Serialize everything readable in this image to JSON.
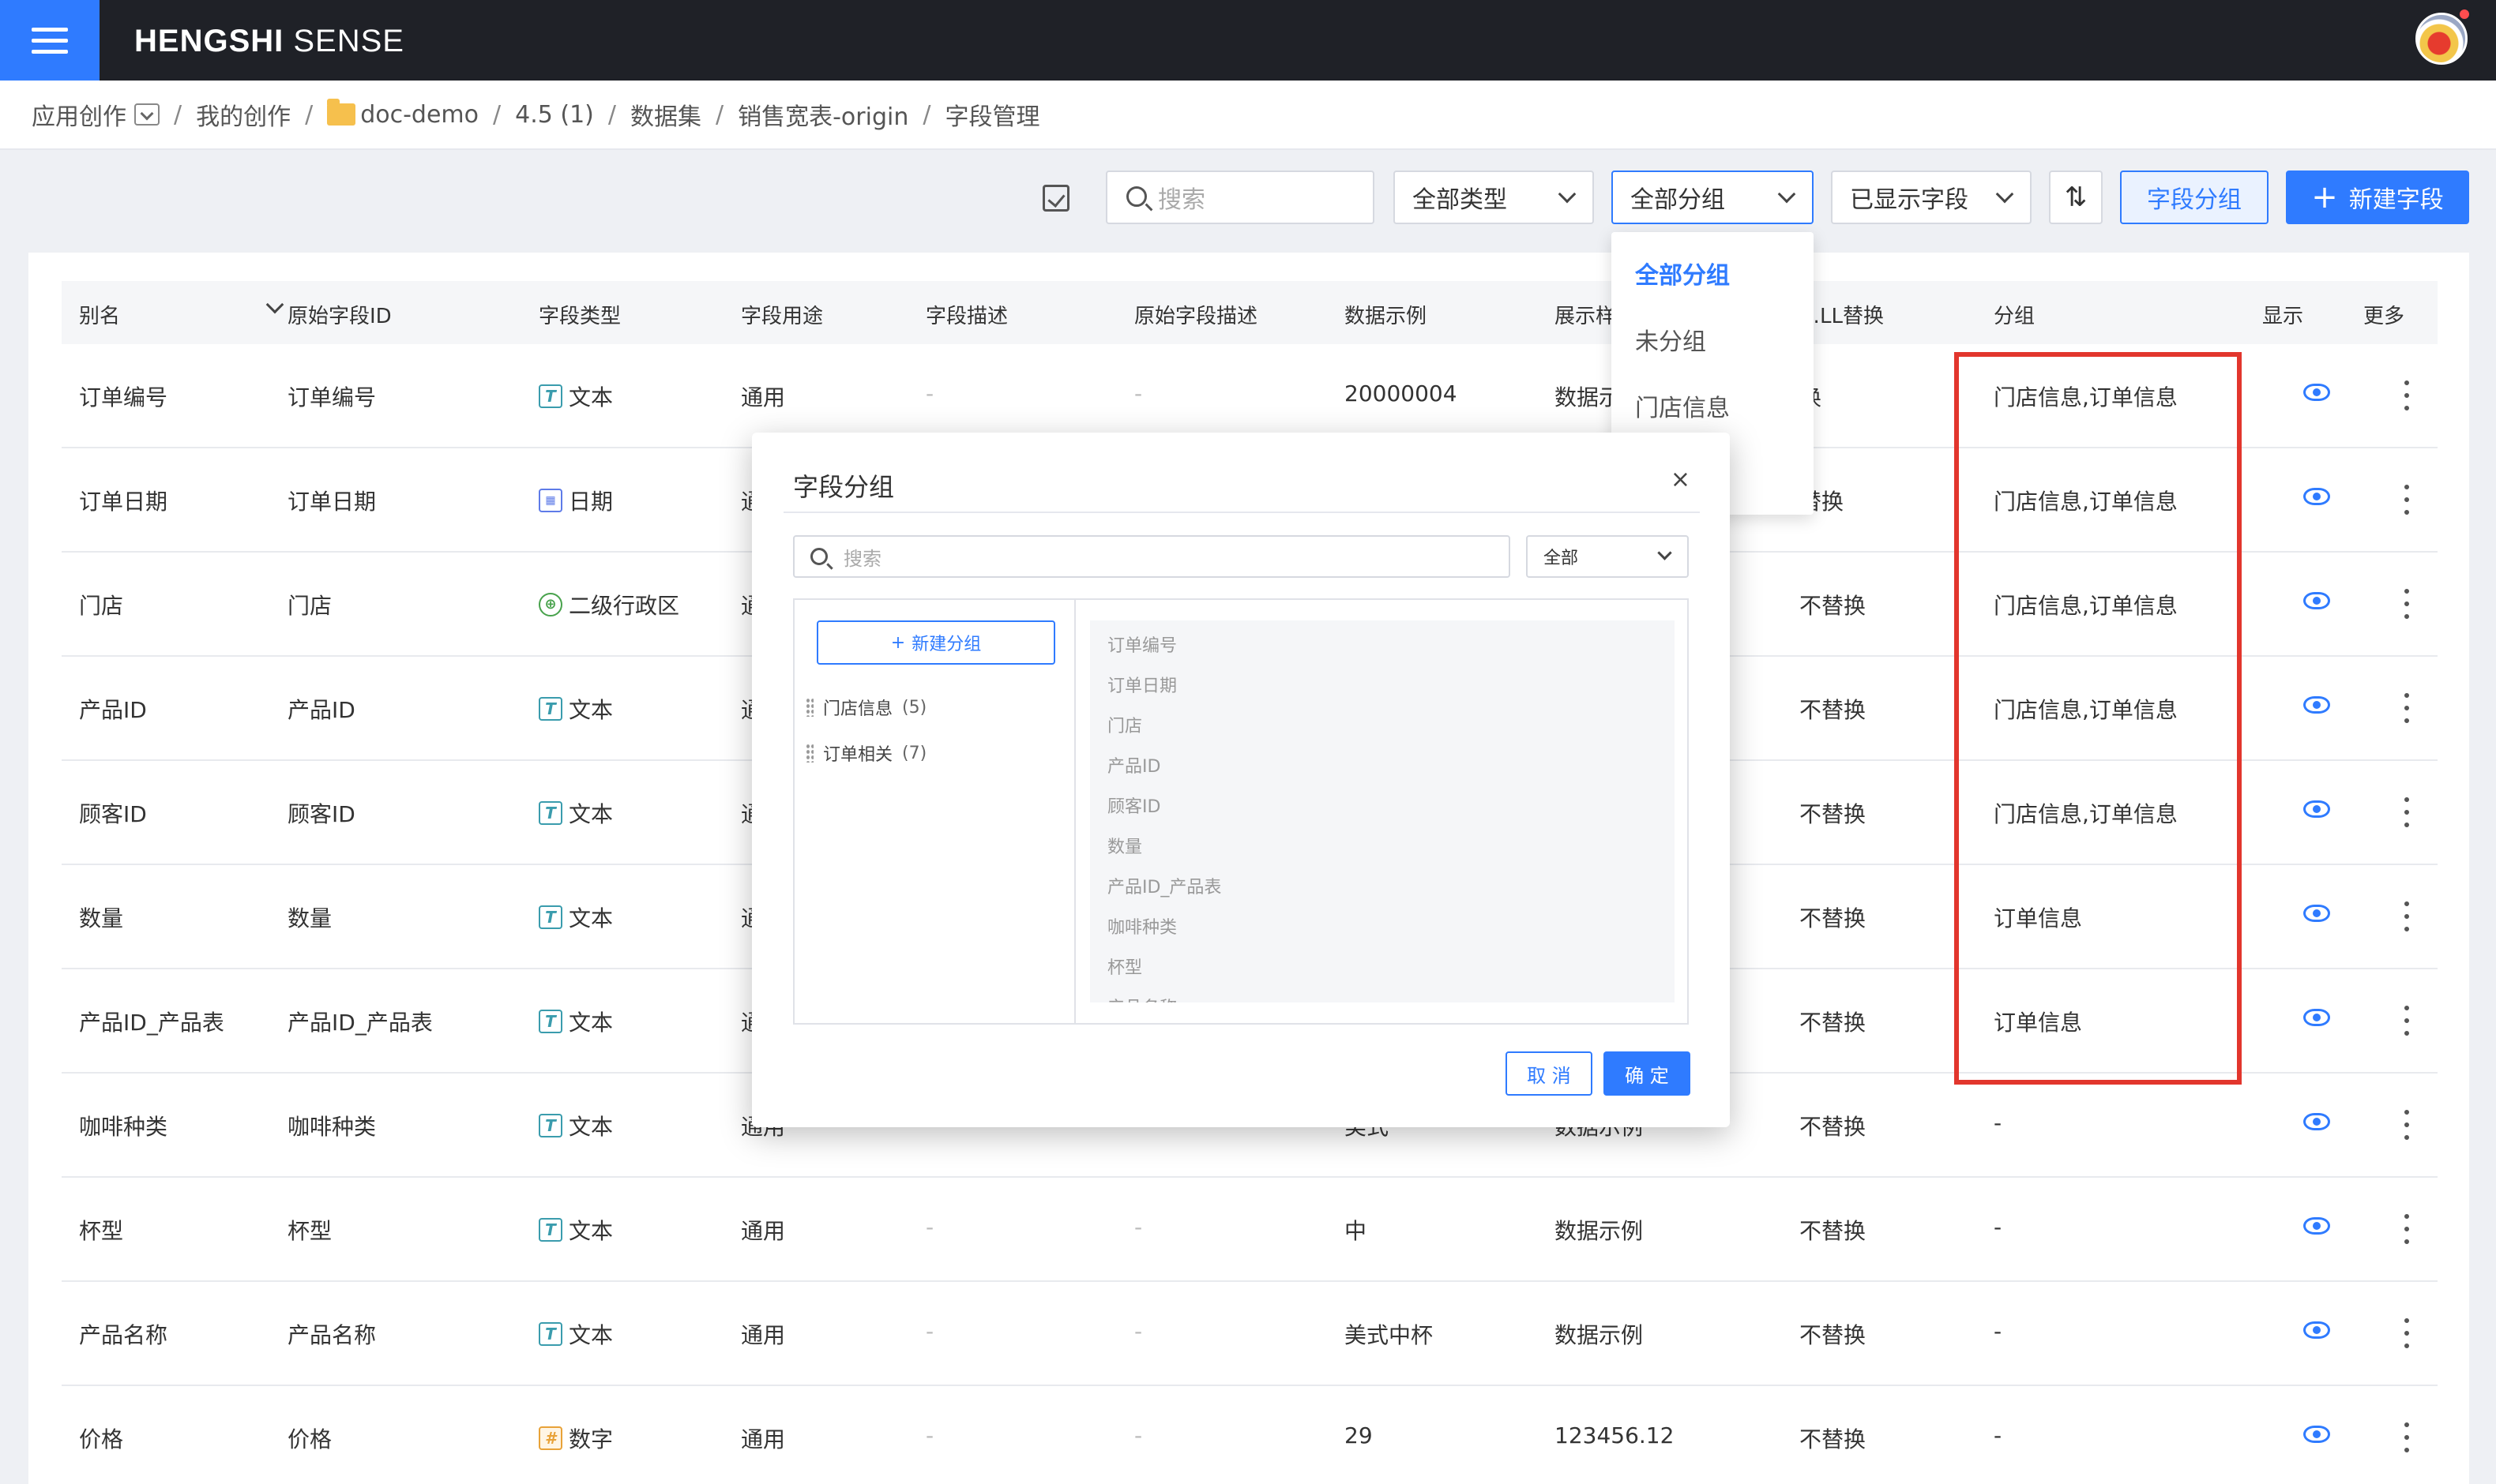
{
  "app": {
    "brand_bold": "HENGSHI",
    "brand_rest": " SENSE"
  },
  "breadcrumb": [
    "应用创作",
    "我的创作",
    "doc-demo",
    "4.5 (1)",
    "数据集",
    "销售宽表-origin",
    "字段管理"
  ],
  "toolbar": {
    "search_placeholder": "搜索",
    "type_filter": "全部类型",
    "group_filter": "全部分组",
    "display_filter": "已显示字段",
    "sort_icon": "sort-icon",
    "group_button": "字段分组",
    "new_field_button": "新建字段"
  },
  "group_dropdown": {
    "options": [
      "全部分组",
      "未分组",
      "门店信息"
    ],
    "selected": "全部分组"
  },
  "table": {
    "headers": [
      "别名",
      "原始字段ID",
      "字段类型",
      "字段用途",
      "字段描述",
      "原始字段描述",
      "数据示例",
      "展示样",
      "…LL替换",
      "分组",
      "显示",
      "更多"
    ],
    "rows": [
      {
        "alias": "订单编号",
        "orig": "订单编号",
        "type": "文本",
        "type_icon": "T",
        "use": "通用",
        "desc": "-",
        "odesc": "-",
        "example": "20000004",
        "display": "数据示",
        "null": "换",
        "group": "门店信息,订单信息"
      },
      {
        "alias": "订单日期",
        "orig": "订单日期",
        "type": "日期",
        "type_icon": "▦",
        "use": "通用",
        "desc": "-",
        "odesc": "-",
        "example": "",
        "display": "",
        "null": "替换",
        "group": "门店信息,订单信息"
      },
      {
        "alias": "门店",
        "orig": "门店",
        "type": "二级行政区",
        "type_icon": "⊕",
        "use": "通用",
        "desc": "-",
        "odesc": "-",
        "example": "",
        "display": "",
        "null": "不替换",
        "group": "门店信息,订单信息"
      },
      {
        "alias": "产品ID",
        "orig": "产品ID",
        "type": "文本",
        "type_icon": "T",
        "use": "通用",
        "desc": "-",
        "odesc": "-",
        "example": "",
        "display": "",
        "null": "不替换",
        "group": "门店信息,订单信息"
      },
      {
        "alias": "顾客ID",
        "orig": "顾客ID",
        "type": "文本",
        "type_icon": "T",
        "use": "通用",
        "desc": "-",
        "odesc": "-",
        "example": "",
        "display": "",
        "null": "不替换",
        "group": "门店信息,订单信息"
      },
      {
        "alias": "数量",
        "orig": "数量",
        "type": "文本",
        "type_icon": "T",
        "use": "通用",
        "desc": "-",
        "odesc": "-",
        "example": "",
        "display": "",
        "null": "不替换",
        "group": "订单信息"
      },
      {
        "alias": "产品ID_产品表",
        "orig": "产品ID_产品表",
        "type": "文本",
        "type_icon": "T",
        "use": "通用",
        "desc": "-",
        "odesc": "-",
        "example": "",
        "display": "",
        "null": "不替换",
        "group": "订单信息"
      },
      {
        "alias": "咖啡种类",
        "orig": "咖啡种类",
        "type": "文本",
        "type_icon": "T",
        "use": "通用",
        "desc": "-",
        "odesc": "-",
        "example": "美式",
        "display": "数据示例",
        "null": "不替换",
        "group": "-"
      },
      {
        "alias": "杯型",
        "orig": "杯型",
        "type": "文本",
        "type_icon": "T",
        "use": "通用",
        "desc": "-",
        "odesc": "-",
        "example": "中",
        "display": "数据示例",
        "null": "不替换",
        "group": "-"
      },
      {
        "alias": "产品名称",
        "orig": "产品名称",
        "type": "文本",
        "type_icon": "T",
        "use": "通用",
        "desc": "-",
        "odesc": "-",
        "example": "美式中杯",
        "display": "数据示例",
        "null": "不替换",
        "group": "-"
      },
      {
        "alias": "价格",
        "orig": "价格",
        "type": "数字",
        "type_icon": "#",
        "use": "通用",
        "desc": "-",
        "odesc": "-",
        "example": "29",
        "display": "123456.12",
        "null": "不替换",
        "group": "-"
      }
    ]
  },
  "dialog": {
    "title": "字段分组",
    "close": "×",
    "search_placeholder": "搜索",
    "filter": "全部",
    "new_group": "新建分组",
    "groups": [
      {
        "name": "门店信息",
        "count": "(5)"
      },
      {
        "name": "订单相关",
        "count": "(7)"
      }
    ],
    "fields": [
      "订单编号",
      "订单日期",
      "门店",
      "产品ID",
      "顾客ID",
      "数量",
      "产品ID_产品表",
      "咖啡种类",
      "杯型",
      "产品名称"
    ],
    "cancel": "取 消",
    "ok": "确 定"
  },
  "colors": {
    "accent": "#2f7bff",
    "highlight": "#e2362d",
    "topbar": "#1f2127"
  }
}
